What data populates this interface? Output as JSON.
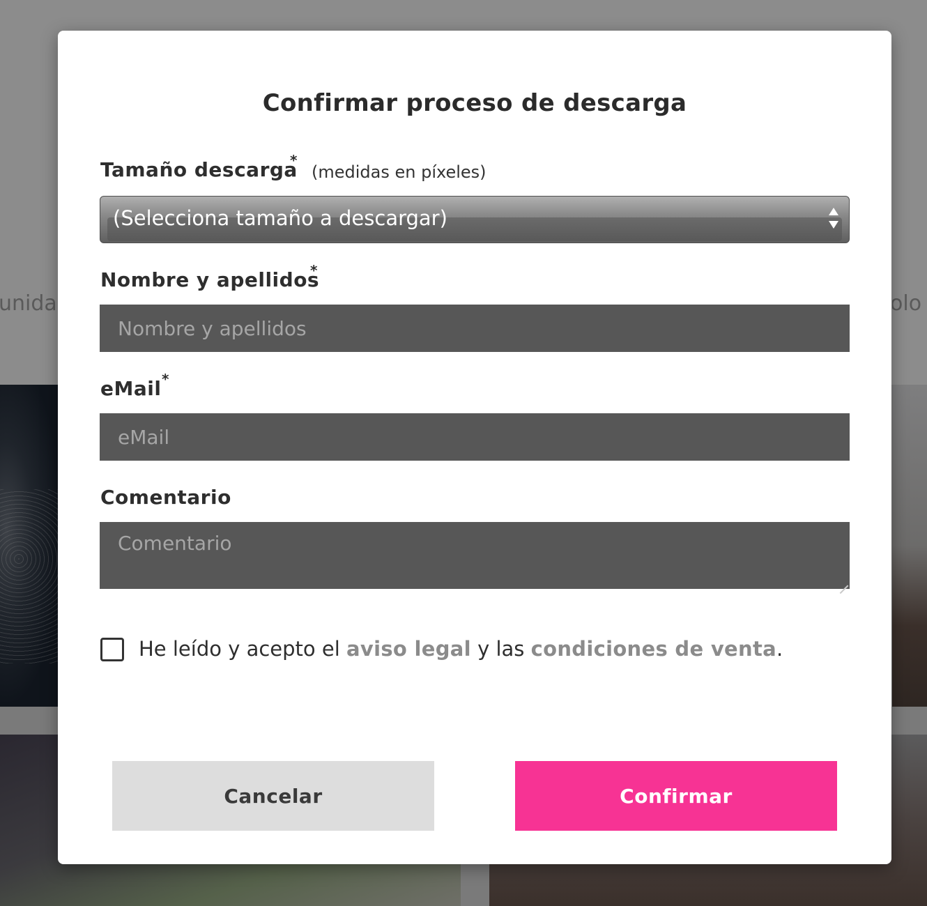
{
  "background": {
    "left_fragment": "unidad",
    "right_fragment": "olo c"
  },
  "modal": {
    "title": "Confirmar proceso de descarga",
    "size_field": {
      "label": "Tamaño descarga",
      "required_mark": "*",
      "hint": "(medidas en píxeles)",
      "selected_value": "(Selecciona tamaño a descargar)"
    },
    "name_field": {
      "label": "Nombre y apellidos",
      "required_mark": "*",
      "placeholder": "Nombre y apellidos",
      "value": ""
    },
    "email_field": {
      "label": "eMail",
      "required_mark": "*",
      "placeholder": "eMail",
      "value": ""
    },
    "comment_field": {
      "label": "Comentario",
      "placeholder": "Comentario",
      "value": ""
    },
    "consent": {
      "checked": false,
      "text_before": "He leído y acepto el ",
      "legal_link": "aviso legal",
      "text_middle": " y las ",
      "terms_link": "condiciones de venta",
      "text_after": "."
    },
    "buttons": {
      "cancel": "Cancelar",
      "confirm": "Confirmar"
    }
  },
  "colors": {
    "confirm_accent": "#f73394",
    "input_background": "#575757",
    "link_gray": "#8b8b8b"
  }
}
